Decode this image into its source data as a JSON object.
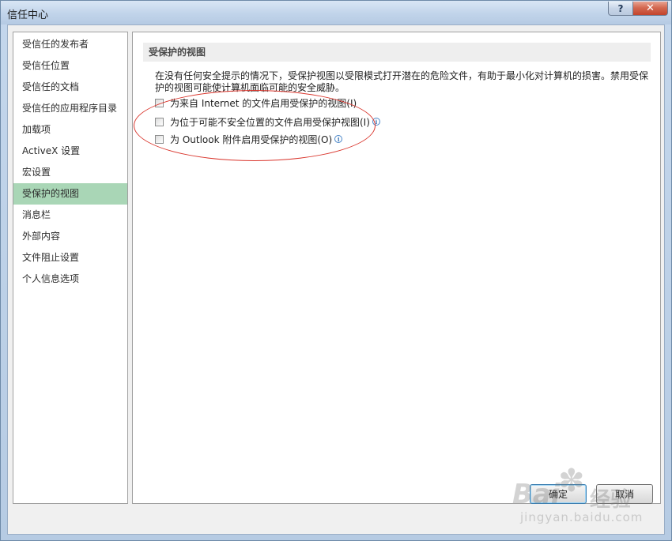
{
  "window": {
    "title": "信任中心"
  },
  "titlebar": {
    "help_label": "?",
    "close_label": "✕"
  },
  "sidebar": {
    "items": [
      {
        "label": "受信任的发布者",
        "active": false
      },
      {
        "label": "受信任位置",
        "active": false
      },
      {
        "label": "受信任的文档",
        "active": false
      },
      {
        "label": "受信任的应用程序目录",
        "active": false
      },
      {
        "label": "加载项",
        "active": false
      },
      {
        "label": "ActiveX 设置",
        "active": false
      },
      {
        "label": "宏设置",
        "active": false
      },
      {
        "label": "受保护的视图",
        "active": true
      },
      {
        "label": "消息栏",
        "active": false
      },
      {
        "label": "外部内容",
        "active": false
      },
      {
        "label": "文件阻止设置",
        "active": false
      },
      {
        "label": "个人信息选项",
        "active": false
      }
    ]
  },
  "main": {
    "section_title": "受保护的视图",
    "description": "在没有任何安全提示的情况下，受保护视图以受限模式打开潜在的危险文件，有助于最小化对计算机的损害。禁用受保护的视图可能使计算机面临可能的安全威胁。",
    "options": [
      {
        "label": "为来自 Internet 的文件启用受保护的视图(I)",
        "checked": false,
        "info_icon": false
      },
      {
        "label": "为位于可能不安全位置的文件启用受保护视图(I)",
        "checked": false,
        "info_icon": true
      },
      {
        "label": "为 Outlook 附件启用受保护的视图(O)",
        "checked": false,
        "info_icon": true
      }
    ]
  },
  "footer": {
    "ok_label": "确定",
    "cancel_label": "取消"
  },
  "watermark": {
    "logo": "Bai",
    "text": "经验",
    "url": "jingyan.baidu.com"
  },
  "colors": {
    "active_nav_bg": "#a9d6b6",
    "annotation_ellipse": "#d9342b",
    "close_button": "#c2432b"
  }
}
